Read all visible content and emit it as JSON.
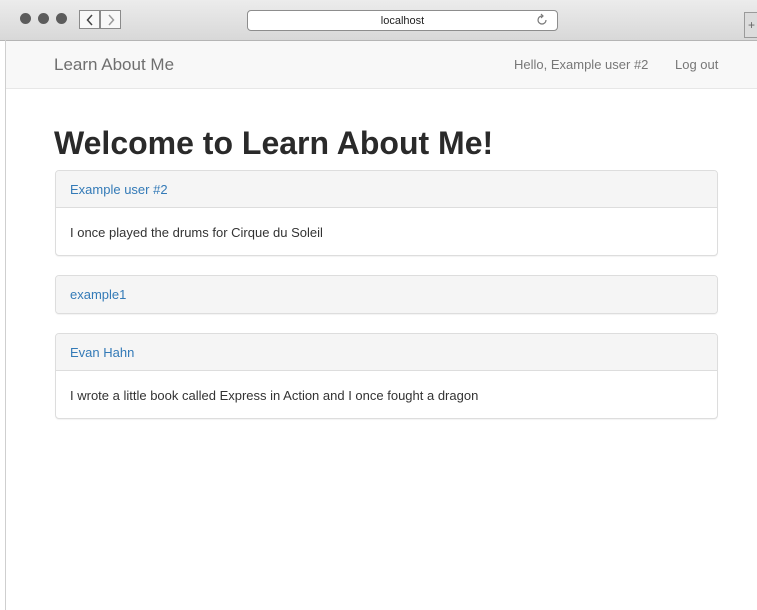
{
  "browser": {
    "url": "localhost",
    "back_icon": "chevron-left",
    "forward_icon": "chevron-right",
    "reload_icon": "reload",
    "new_tab_label": "+"
  },
  "navbar": {
    "brand": "Learn About Me",
    "greeting": "Hello, Example user #2",
    "logout": "Log out"
  },
  "page": {
    "title": "Welcome to Learn About Me!"
  },
  "users": [
    {
      "name": "Example user #2",
      "bio": "I once played the drums for Cirque du Soleil"
    },
    {
      "name": "example1",
      "bio": ""
    },
    {
      "name": "Evan Hahn",
      "bio": "I wrote a little book called Express in Action and I once fought a dragon"
    }
  ],
  "colors": {
    "link": "#337ab7",
    "navbar_bg": "#f8f8f8",
    "panel_heading_bg": "#f5f5f5"
  }
}
